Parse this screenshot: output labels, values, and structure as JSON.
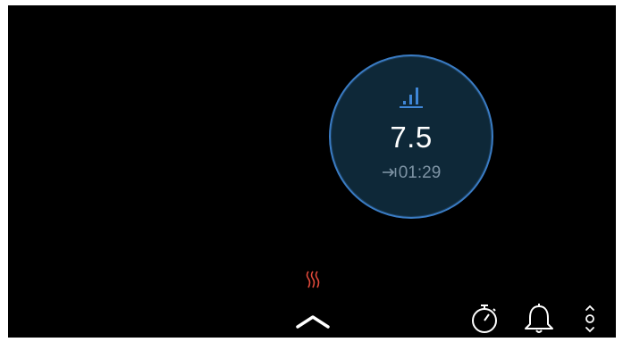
{
  "dial": {
    "level": "7.5",
    "remaining_time": "01:29",
    "icon": "power-level-icon"
  },
  "status": {
    "heating_icon": "heating-indicator-icon"
  },
  "controls": {
    "up": "chevron-up-icon",
    "timer": "stopwatch-icon",
    "alarm": "bell-icon",
    "more": "up-down-arrows-icon"
  },
  "colors": {
    "background": "#000000",
    "dial_fill": "#0e2838",
    "dial_ring": "#3a7cc4",
    "accent_blue": "#3f86d6",
    "heat_red": "#e0493a",
    "muted_text": "#7d93a4"
  }
}
